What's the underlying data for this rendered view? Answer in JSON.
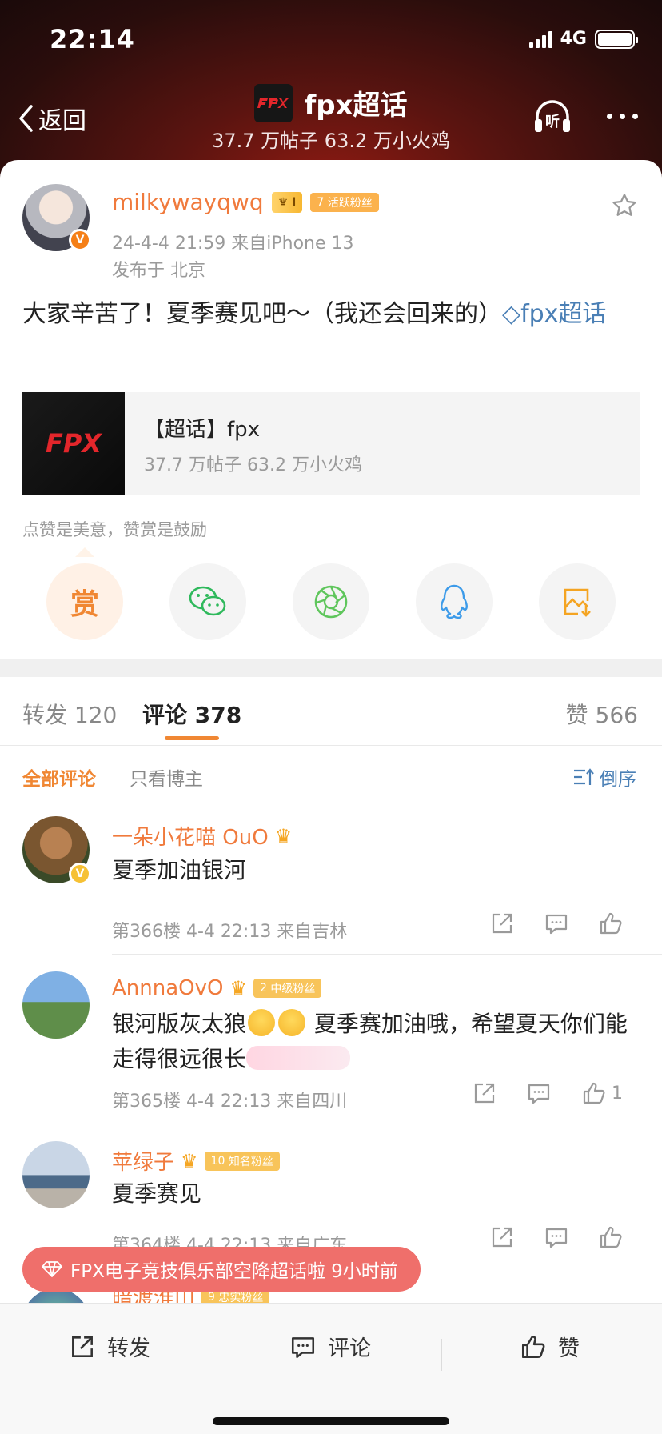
{
  "status_bar": {
    "time": "22:14",
    "network": "4G"
  },
  "header": {
    "back_label": "返回",
    "title": "fpx超话",
    "subtitle": "37.7 万帖子 63.2 万小火鸡"
  },
  "post": {
    "username": "milkywayqwq",
    "level_badge": "I",
    "fan_badge": "活跃粉丝",
    "fan_level": "7",
    "meta": "24-4-4 21:59  来自iPhone 13",
    "location": "发布于 北京",
    "text": "大家辛苦了！夏季赛见吧～（我还会回来的）",
    "topic_link": "fpx超话",
    "topic_card": {
      "logo": "FPX",
      "title": "【超话】fpx",
      "subtitle": "37.7 万帖子 63.2 万小火鸡"
    },
    "reward_hint": "点赞是美意，赞赏是鼓励",
    "reward_button": "赏"
  },
  "tabs": {
    "repost": "转发 120",
    "comments": "评论 378",
    "likes": "赞 566"
  },
  "filters": {
    "all": "全部评论",
    "owner_only": "只看博主",
    "sort": "倒序"
  },
  "comments": [
    {
      "name": "一朵小花喵 OuO",
      "text": "夏季加油银河",
      "meta": "第366楼 4-4 22:13 来自吉林",
      "likes": ""
    },
    {
      "name": "AnnnaOvO",
      "badge": "中级粉丝",
      "badge_level": "2",
      "text_a": "银河版灰太狼",
      "text_b": "夏季赛加油哦，希望夏天你们能走得很远很长",
      "meta": "第365楼 4-4 22:13 来自四川",
      "likes": "1"
    },
    {
      "name": "苹绿子",
      "badge": "知名粉丝",
      "badge_level": "10",
      "text": "夏季赛见",
      "meta": "第364楼 4-4 22:13 来自广东",
      "likes": ""
    },
    {
      "name": "暗渡淮山",
      "badge": "忠实粉丝",
      "badge_level": "9"
    }
  ],
  "toast": "FPX电子竞技俱乐部空降超话啦 9小时前",
  "bottom_bar": {
    "repost": "转发",
    "comment": "评论",
    "like": "赞"
  },
  "colors": {
    "accent_orange": "#f08733",
    "link_blue": "#4a7fb5",
    "toast_red": "#ef6f6b"
  }
}
